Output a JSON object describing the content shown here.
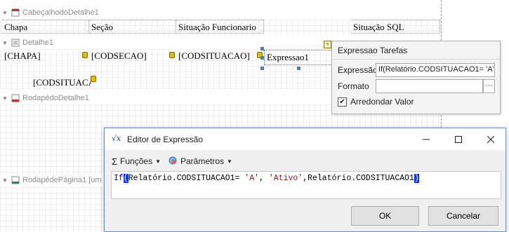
{
  "bands": {
    "header": {
      "label": "CabeçalhodoDetalhe1"
    },
    "detail": {
      "label": "Detalhe1"
    },
    "footer": {
      "label": "RodapédoDetalhe1"
    },
    "page_footer": {
      "label": "RodapédePágina1 [um"
    }
  },
  "header_cells": [
    "Chapa",
    "Seção",
    "Situação Funcionario",
    "Situação SQL"
  ],
  "detail_cells": [
    "[CHAPA]",
    "[CODSECAO]",
    "[CODSITUACAO]",
    "Expressao1"
  ],
  "detail_extra_cell": "[CODSITUACA",
  "tasks": {
    "title": "Expressao Tarefas",
    "expression_label": "Expressão",
    "expression_value": "If(Relatório.CODSITUACAO1= 'A'",
    "format_label": "Formato",
    "format_value": "",
    "format_btn": "···",
    "round_label": "Arredondar Valor",
    "round_checked": true
  },
  "dialog": {
    "title": "Editor de Expressão",
    "functions_label": "Funções",
    "parameters_label": "Parâmetros",
    "expr_if": "If",
    "expr_open_paren": "(",
    "expr_part1": "Relatório.CODSITUACAO1= ",
    "expr_str1": "'A'",
    "expr_part2": ", ",
    "expr_str2": "'Ativo'",
    "expr_part3": ",Relatório.CODSITUACAO1",
    "expr_close_paren": ")",
    "ok_label": "OK",
    "cancel_label": "Cancelar"
  }
}
